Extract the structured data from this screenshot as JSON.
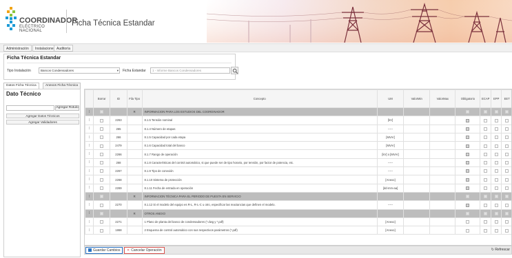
{
  "header": {
    "logo_line1": "COORDINADOR",
    "logo_line2": "ELÉCTRICO NACIONAL",
    "title": "Ficha Técnica Estandar"
  },
  "menu": [
    {
      "label": "Administración"
    },
    {
      "label": "Instalaciones"
    },
    {
      "label": "Auditoría"
    }
  ],
  "ficha_panel": {
    "title": "Ficha Técnica Estandar",
    "tipo_label": "Tipo Instalación",
    "tipo_value": "Bancos Condensadores",
    "ficha_label": "Ficha Estandar",
    "ficha_placeholder": "1 - Informe Bancos Condensadores"
  },
  "tabs": [
    {
      "label": "Datos Ficha Técnica",
      "active": true
    },
    {
      "label": "Anexos Ficha Técnica",
      "active": false
    }
  ],
  "left_panel": {
    "title": "Dato Técnico",
    "rotulo_button": "Agregar Rotulo",
    "buttons": [
      "Agregar Datos Técnicos",
      "Agregar Validadores"
    ]
  },
  "table": {
    "columns": [
      "",
      "Borrar",
      "ID",
      "Fila Tipo",
      "Concepto",
      "UM",
      "ValorMin",
      "ValorMax",
      "Obligatorio",
      "ECAP",
      "EPP",
      "EET"
    ],
    "rows": [
      {
        "section": true,
        "id": "",
        "tipo": "R",
        "concepto": "INFORMACION PARA LOS ESTUDIOS DEL COORDINADOR",
        "um": "",
        "obligatorio": false
      },
      {
        "section": false,
        "id": "2263",
        "tipo": "",
        "concepto": "8.1.5 Tensión nominal",
        "um": "[kV]",
        "obligatorio": true
      },
      {
        "section": false,
        "id": "265",
        "tipo": "",
        "concepto": "8.1.4 Número de etapas",
        "um": "-----",
        "obligatorio": true
      },
      {
        "section": false,
        "id": "266",
        "tipo": "",
        "concepto": "8.1.5 Capacidad por cada etapa",
        "um": "[MVAr]",
        "obligatorio": true
      },
      {
        "section": false,
        "id": "2479",
        "tipo": "",
        "concepto": "8.1.6 Capacidad total del banco",
        "um": "[MVAr]",
        "obligatorio": true
      },
      {
        "section": false,
        "id": "2266",
        "tipo": "",
        "concepto": "8.1.7 Rango de operación",
        "um": "[kV] o [MVAr]",
        "obligatorio": true
      },
      {
        "section": false,
        "id": "268",
        "tipo": "",
        "concepto": "8.1.8 Características del control automático, si que puede ser de tipo horario, por tensión, por factor de potencia, etc.",
        "um": "-----",
        "obligatorio": true
      },
      {
        "section": false,
        "id": "2267",
        "tipo": "",
        "concepto": "8.1.9 Tipo de conexión",
        "um": "-----",
        "obligatorio": true
      },
      {
        "section": false,
        "id": "2268",
        "tipo": "",
        "concepto": "8.1.10 Sistema de protección",
        "um": "[Anexo]",
        "obligatorio": true
      },
      {
        "section": false,
        "id": "2269",
        "tipo": "",
        "concepto": "8.1.11 Fecha de entrada en operación",
        "um": "[dd-mm-aa]",
        "obligatorio": true
      },
      {
        "section": true,
        "id": "",
        "tipo": "R",
        "concepto": "INFORMACION TÉCNICA PARA EL PERIODO DE PUESTA EN SERVICIO",
        "um": "",
        "obligatorio": false
      },
      {
        "section": false,
        "id": "2270",
        "tipo": "",
        "concepto": "8.1.12 Si el modelo del equipo es R-L, R-L-C u otro, especificar las reactancias que definen el modelo.",
        "um": "-----",
        "obligatorio": true
      },
      {
        "section": true,
        "id": "",
        "tipo": "R",
        "concepto": "OTROS ANEXO",
        "um": "",
        "obligatorio": false
      },
      {
        "section": false,
        "id": "2271",
        "tipo": "",
        "concepto": "1 Plano de planta del banco de condensadores (*.dwg y *.pdf)",
        "um": "[Anexo]",
        "obligatorio": false
      },
      {
        "section": false,
        "id": "1868",
        "tipo": "",
        "concepto": "2 Esquema de control automático con sus respectivos parámetros (*.pdf)",
        "um": "[Anexo]",
        "obligatorio": false
      }
    ]
  },
  "footer": {
    "save_label": "Guardar Cambios",
    "cancel_label": "Cancelar Operación",
    "refresh_label": "Refrescar"
  }
}
